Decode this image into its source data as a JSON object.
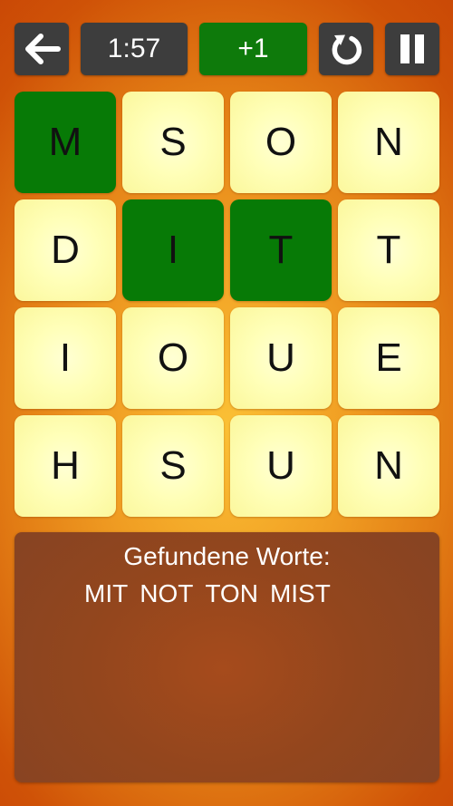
{
  "topbar": {
    "back_icon": "arrow-left-icon",
    "timer": "1:57",
    "score_delta": "+1",
    "restart_icon": "rotate-icon",
    "pause_icon": "pause-icon"
  },
  "board": {
    "rows": [
      [
        {
          "letter": "M",
          "selected": true
        },
        {
          "letter": "S",
          "selected": false
        },
        {
          "letter": "O",
          "selected": false
        },
        {
          "letter": "N",
          "selected": false
        }
      ],
      [
        {
          "letter": "D",
          "selected": false
        },
        {
          "letter": "I",
          "selected": true
        },
        {
          "letter": "T",
          "selected": true
        },
        {
          "letter": "T",
          "selected": false
        }
      ],
      [
        {
          "letter": "I",
          "selected": false
        },
        {
          "letter": "O",
          "selected": false
        },
        {
          "letter": "U",
          "selected": false
        },
        {
          "letter": "E",
          "selected": false
        }
      ],
      [
        {
          "letter": "H",
          "selected": false
        },
        {
          "letter": "S",
          "selected": false
        },
        {
          "letter": "U",
          "selected": false
        },
        {
          "letter": "N",
          "selected": false
        }
      ]
    ]
  },
  "found": {
    "title": "Gefundene Worte:",
    "words": [
      "MIT",
      "NOT",
      "TON",
      "MIST"
    ]
  },
  "colors": {
    "selected_tile": "#077a06",
    "tile": "#ffffb8",
    "button": "#3d3d3d",
    "score_button": "#0e7a0b",
    "panel": "#93461d"
  }
}
